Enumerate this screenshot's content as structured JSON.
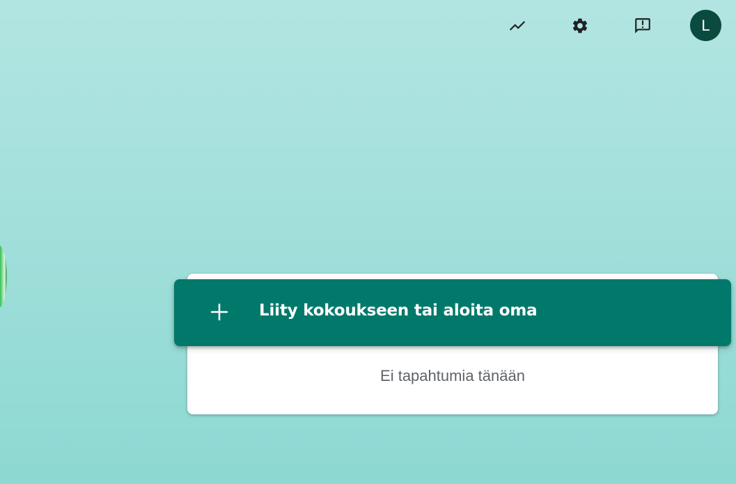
{
  "topbar": {
    "icons": [
      "activity-icon",
      "settings-icon",
      "feedback-icon"
    ],
    "avatar_initial": "L",
    "avatar_color": "#0a4a3f"
  },
  "main": {
    "join_button_label": "Liity kokoukseen tai aloita oma",
    "join_button_icon": "plus-icon",
    "join_button_color": "#00796b",
    "empty_state_text": "Ei tapahtumia tänään"
  },
  "colors": {
    "background_top": "#b2e5e2",
    "background_bottom": "#8dd8d2"
  }
}
